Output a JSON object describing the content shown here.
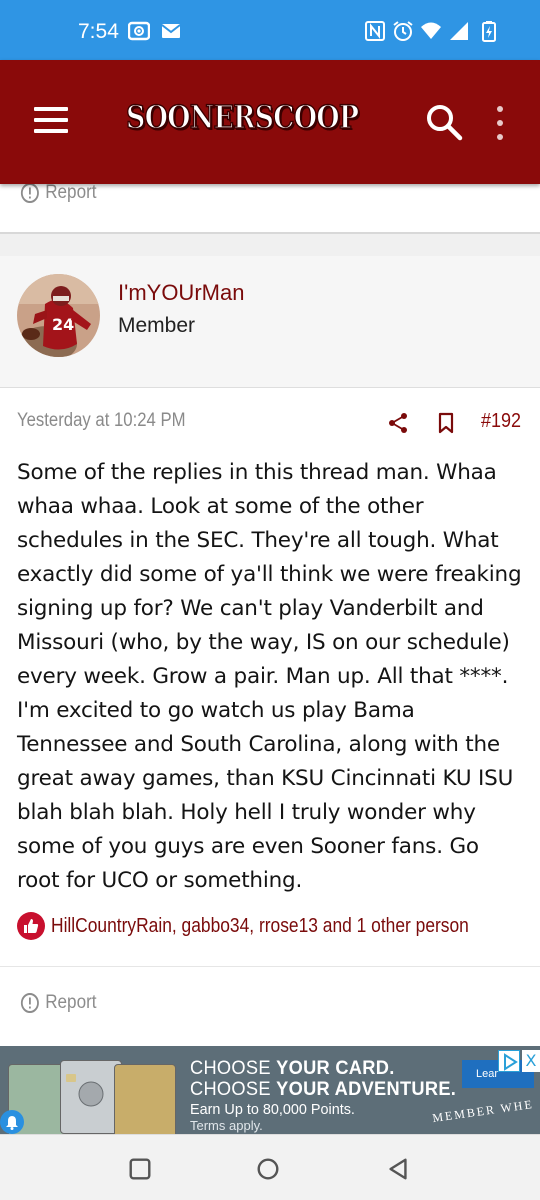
{
  "status_bar": {
    "time": "7:54",
    "icons": [
      "screen-record-icon",
      "mail-icon",
      "nfc-icon",
      "alarm-icon",
      "wifi-icon",
      "signal-icon",
      "battery-charging-icon"
    ]
  },
  "header": {
    "logo": "SOONERSCOOP",
    "brand_color": "#8a0a0a"
  },
  "prev_post": {
    "report_label": "Report"
  },
  "post": {
    "username": "I'mYOUrMan",
    "role": "Member",
    "date": "Yesterday at 10:24 PM",
    "number": "#192",
    "body_lines": [
      "Some of the replies in this thread man. Whaa",
      "whaa whaa. Look at some of the other",
      "schedules in the SEC. They're all tough. What",
      "exactly did some of ya'll think we were freaking",
      "signing up for? We can't play Vanderbilt and",
      "Missouri (who, by the way, IS on our schedule)",
      "every week. Grow a pair. Man up. All that ****.",
      "I'm excited to go watch us play Bama",
      "Tennessee and South Carolina, along with the",
      "great away games, than KSU Cincinnati KU ISU",
      "blah blah blah. Holy hell I truly wonder why",
      "some of you guys are even Sooner fans. Go",
      "root for UCO or something."
    ],
    "reactions": "HillCountryRain, gabbo34, rrose13 and 1 other person",
    "report_label": "Report"
  },
  "ad": {
    "headline_1a": "CHOOSE ",
    "headline_1b": "YOUR CARD.",
    "headline_2a": "CHOOSE ",
    "headline_2b": "YOUR ADVENTURE.",
    "subline": "Earn Up to 80,000 Points.",
    "terms": "Terms apply.",
    "learn_label": "Lear",
    "member_text": "MEMBER WHE",
    "close_label": "X"
  },
  "nav": {
    "buttons": [
      "recents-button",
      "home-button",
      "back-button"
    ]
  }
}
